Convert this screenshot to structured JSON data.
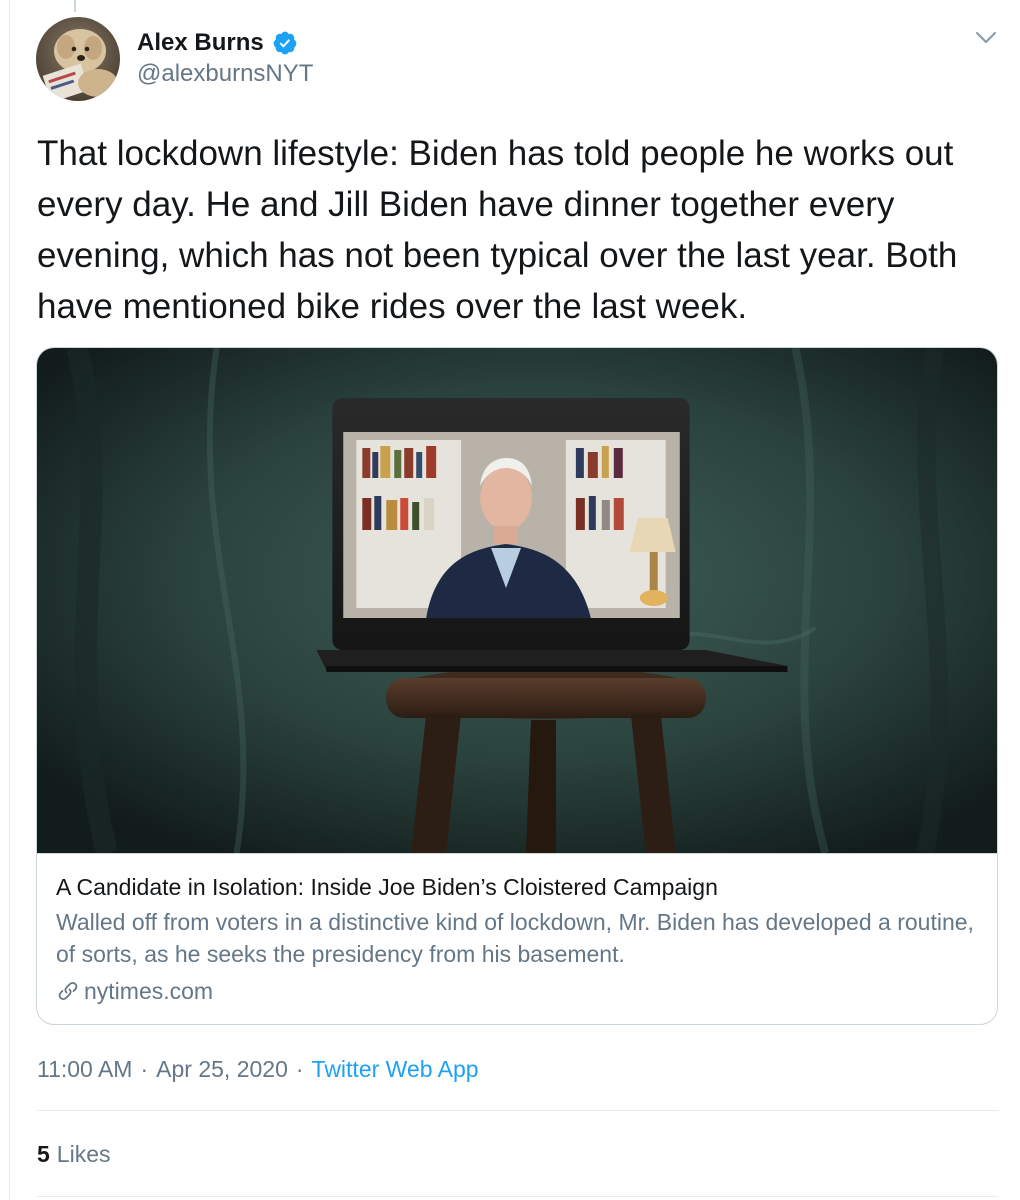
{
  "tweet": {
    "author": {
      "name": "Alex Burns",
      "handle": "@alexburnsNYT",
      "verified": true,
      "avatar_icon": "dog-avatar"
    },
    "menu_icon": "chevron-down-icon",
    "text": "That lockdown lifestyle: Biden has told people he works out every day. He and Jill Biden have dinner together every evening, which has not been typical over the last year. Both have mentioned bike rides over the last week.",
    "card": {
      "image_subject": "laptop-on-stool-video-call",
      "title": "A Candidate in Isolation: Inside Joe Biden’s Cloistered Campaign",
      "description": "Walled off from voters in a distinctive kind of lockdown, Mr. Biden has developed a routine, of sorts, as he seeks the presidency from his basement.",
      "domain": "nytimes.com",
      "link_icon": "link-icon"
    },
    "meta": {
      "time": "11:00 AM",
      "separator": "·",
      "date": "Apr 25, 2020",
      "source": "Twitter Web App"
    },
    "likes": {
      "count": "5",
      "label": "Likes"
    }
  },
  "colors": {
    "text_primary": "#14171a",
    "text_secondary": "#657786",
    "accent": "#1da1f2",
    "border": "#ccd6dd",
    "divider": "#e6ecf0"
  }
}
